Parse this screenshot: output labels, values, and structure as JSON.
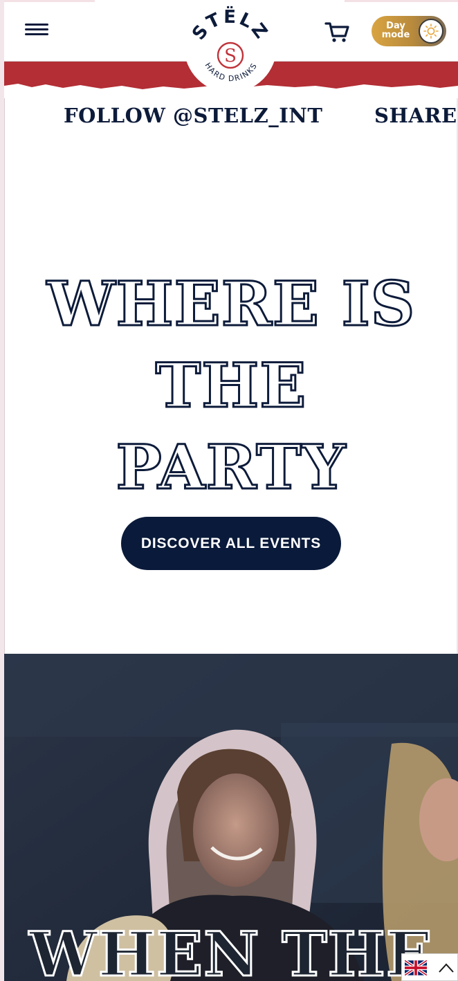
{
  "header": {
    "menu_icon": "hamburger-menu-icon",
    "cart_icon": "shopping-cart-icon",
    "mode_toggle": {
      "label_line1": "Day",
      "label_line2": "mode",
      "icon": "sun-icon"
    },
    "logo": {
      "brand": "STËLZ",
      "tagline": "HARD DRINKS",
      "monogram": "S"
    }
  },
  "marquee": {
    "items": [
      "FOLLOW @STELZ_INT",
      "SHARE YO"
    ]
  },
  "hero": {
    "headline_line1": "WHERE IS THE",
    "headline_line2": "PARTY",
    "cta_label": "DISCOVER ALL EVENTS"
  },
  "photo_section": {
    "overlay_title": "WHEN THE"
  },
  "language_switcher": {
    "flag_icon": "uk-flag-icon",
    "chevron_icon": "chevron-up-icon"
  },
  "colors": {
    "navy": "#0d1b3a",
    "red": "#b32e35",
    "gold": "#d9a441"
  }
}
